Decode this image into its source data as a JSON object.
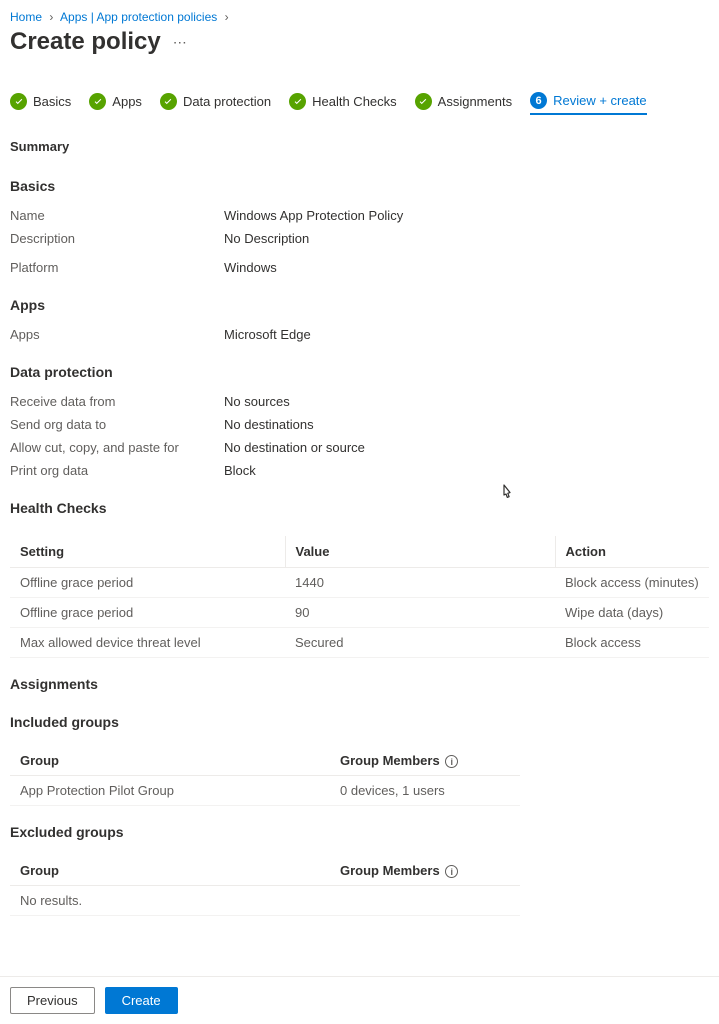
{
  "breadcrumb": {
    "home": "Home",
    "apps": "Apps | App protection policies"
  },
  "page_title": "Create policy",
  "tabs": {
    "basics": "Basics",
    "apps": "Apps",
    "data_protection": "Data protection",
    "health_checks": "Health Checks",
    "assignments": "Assignments",
    "review_create": "Review + create",
    "review_step_num": "6"
  },
  "summary_heading": "Summary",
  "basics": {
    "heading": "Basics",
    "name_label": "Name",
    "name_value": "Windows App Protection Policy",
    "description_label": "Description",
    "description_value": "No Description",
    "platform_label": "Platform",
    "platform_value": "Windows"
  },
  "apps_section": {
    "heading": "Apps",
    "apps_label": "Apps",
    "apps_value": "Microsoft Edge"
  },
  "data_protection": {
    "heading": "Data protection",
    "receive_label": "Receive data from",
    "receive_value": "No sources",
    "send_label": "Send org data to",
    "send_value": "No destinations",
    "cut_label": "Allow cut, copy, and paste for",
    "cut_value": "No destination or source",
    "print_label": "Print org data",
    "print_value": "Block"
  },
  "health_checks": {
    "heading": "Health Checks",
    "col_setting": "Setting",
    "col_value": "Value",
    "col_action": "Action",
    "rows": [
      {
        "setting": "Offline grace period",
        "value": "1440",
        "action": "Block access (minutes)"
      },
      {
        "setting": "Offline grace period",
        "value": "90",
        "action": "Wipe data (days)"
      },
      {
        "setting": "Max allowed device threat level",
        "value": "Secured",
        "action": "Block access"
      }
    ]
  },
  "assignments": {
    "heading": "Assignments",
    "included_heading": "Included groups",
    "excluded_heading": "Excluded groups",
    "col_group": "Group",
    "col_members": "Group Members",
    "included_rows": [
      {
        "group": "App Protection Pilot Group",
        "members": "0 devices, 1 users"
      }
    ],
    "no_results": "No results."
  },
  "footer": {
    "previous": "Previous",
    "create": "Create"
  }
}
